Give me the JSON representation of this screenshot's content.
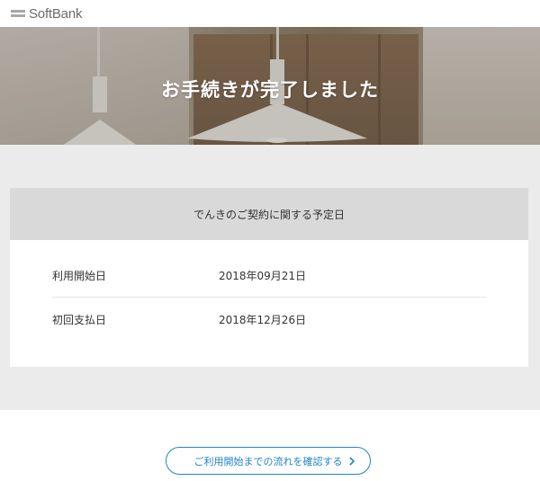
{
  "header": {
    "logo_text": "SoftBank",
    "logo_icon": "softbank-bars-logo"
  },
  "hero": {
    "title": "お手続きが完了しました"
  },
  "schedule_card": {
    "heading": "でんきのご契約に関する予定日",
    "rows": [
      {
        "label": "利用開始日",
        "value": "2018年09月21日"
      },
      {
        "label": "初回支払日",
        "value": "2018年12月26日"
      }
    ]
  },
  "flow_button": {
    "label": "ご利用開始までの流れを確認する",
    "icon": "chevron-right-icon"
  },
  "colors": {
    "accent": "#1f84c5",
    "section_bg": "#ebebeb",
    "card_header_bg": "#d9d9d9"
  }
}
